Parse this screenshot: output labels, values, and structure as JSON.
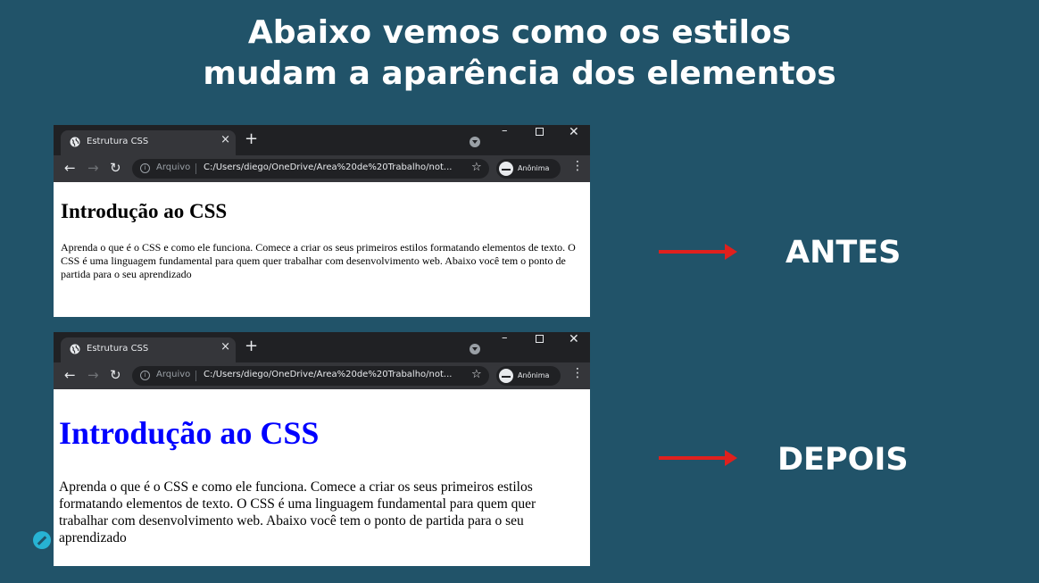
{
  "slide": {
    "title_line1": "Abaixo vemos como os estilos",
    "title_line2": "mudam a aparência dos elementos",
    "label_before": "ANTES",
    "label_after": "DEPOIS",
    "arrow_color": "#e0201d",
    "background_color": "#215369"
  },
  "browser": {
    "tab_title": "Estrutura CSS",
    "tab_close": "×",
    "new_tab": "+",
    "win_minimize": "–",
    "win_close": "✕",
    "back": "←",
    "forward": "→",
    "reload": "↻",
    "scheme_label": "Arquivo",
    "url": "C:/Users/diego/OneDrive/Área%20de%20Trabalho/not...",
    "star": "☆",
    "incognito_label": "Anônima",
    "menu": "⋮",
    "icons": [
      "globe-icon",
      "tab-search-icon",
      "info-icon",
      "star-icon",
      "incognito-icon",
      "menu-icon"
    ]
  },
  "page_before": {
    "heading": "Introdução ao CSS",
    "paragraph": "Aprenda o que é o CSS e como ele funciona. Comece a criar os seus primeiros estilos formatando elementos de texto. O CSS é uma linguagem fundamental para quem quer trabalhar com desenvolvimento web. Abaixo você tem o ponto de partida para o seu aprendizado"
  },
  "page_after": {
    "heading": "Introdução ao CSS",
    "heading_color": "#0000ff",
    "paragraph": "Aprenda o que é o CSS e como ele funciona. Comece a criar os seus primeiros estilos formatando elementos de texto. O CSS é uma linguagem fundamental para quem quer trabalhar com desenvolvimento web. Abaixo você tem o ponto de partida para o seu aprendizado"
  }
}
